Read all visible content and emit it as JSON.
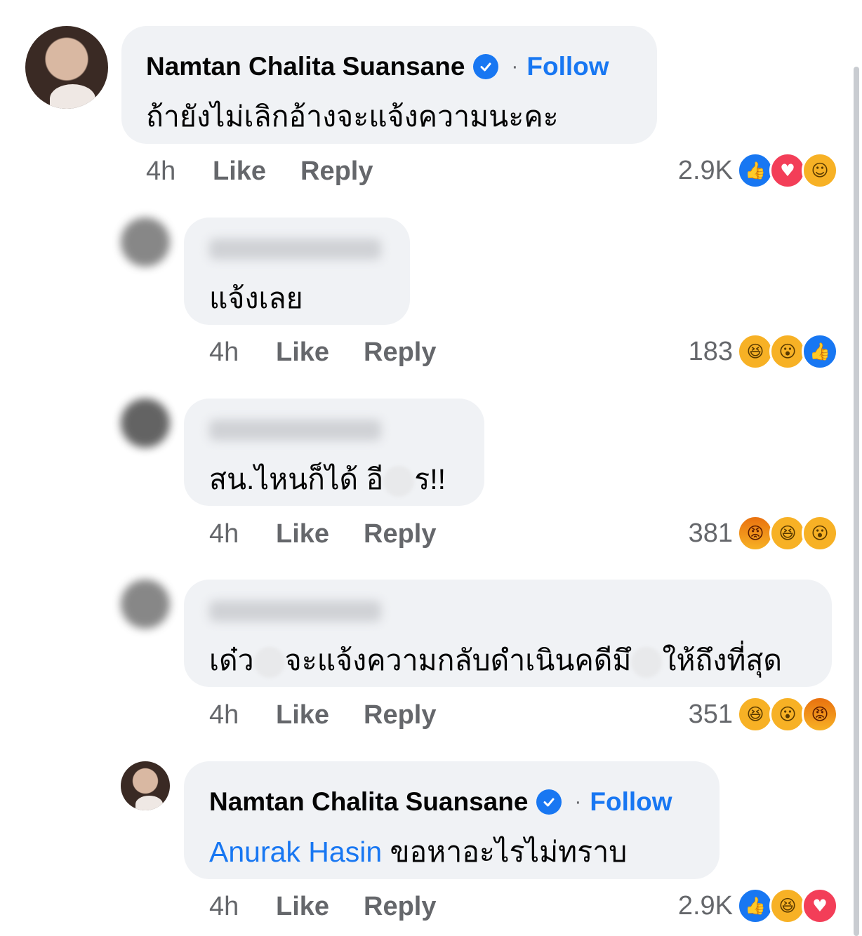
{
  "comments": [
    {
      "author": "Namtan Chalita Suansane",
      "verified": true,
      "follow_label": "Follow",
      "text": "ถ้ายังไม่เลิกอ้างจะแจ้งความนะคะ",
      "time": "4h",
      "like_label": "Like",
      "reply_label": "Reply",
      "reaction_count": "2.9K",
      "reactions": [
        "like-icon",
        "love-icon",
        "care-icon"
      ]
    },
    {
      "author_blurred": true,
      "text": "แจ้งเลย",
      "time": "4h",
      "like_label": "Like",
      "reply_label": "Reply",
      "reaction_count": "183",
      "reactions": [
        "haha-icon",
        "wow-icon",
        "like-icon"
      ]
    },
    {
      "author_blurred": true,
      "text_before": "สน.ไหนก็ได้ อี",
      "text_after": "ร!!",
      "time": "4h",
      "like_label": "Like",
      "reply_label": "Reply",
      "reaction_count": "381",
      "reactions": [
        "angry-icon",
        "haha-icon",
        "wow-icon"
      ]
    },
    {
      "author_blurred": true,
      "text_part1": "เด๋ว",
      "text_part2": "จะแจ้งความกลับดำเนินคดีมึ",
      "text_part3": "ให้ถึงที่สุด",
      "time": "4h",
      "like_label": "Like",
      "reply_label": "Reply",
      "reaction_count": "351",
      "reactions": [
        "haha-icon",
        "wow-icon",
        "angry-icon"
      ]
    },
    {
      "author": "Namtan Chalita Suansane",
      "verified": true,
      "follow_label": "Follow",
      "mention": "Anurak Hasin",
      "text": " ขอหาอะไรไม่ทราบ",
      "time": "4h",
      "like_label": "Like",
      "reply_label": "Reply",
      "reaction_count": "2.9K",
      "reactions": [
        "like-icon",
        "haha-icon",
        "love-icon"
      ]
    }
  ],
  "colors": {
    "bubble": "#f0f2f5",
    "accent": "#1877f2",
    "meta": "#65676b"
  }
}
